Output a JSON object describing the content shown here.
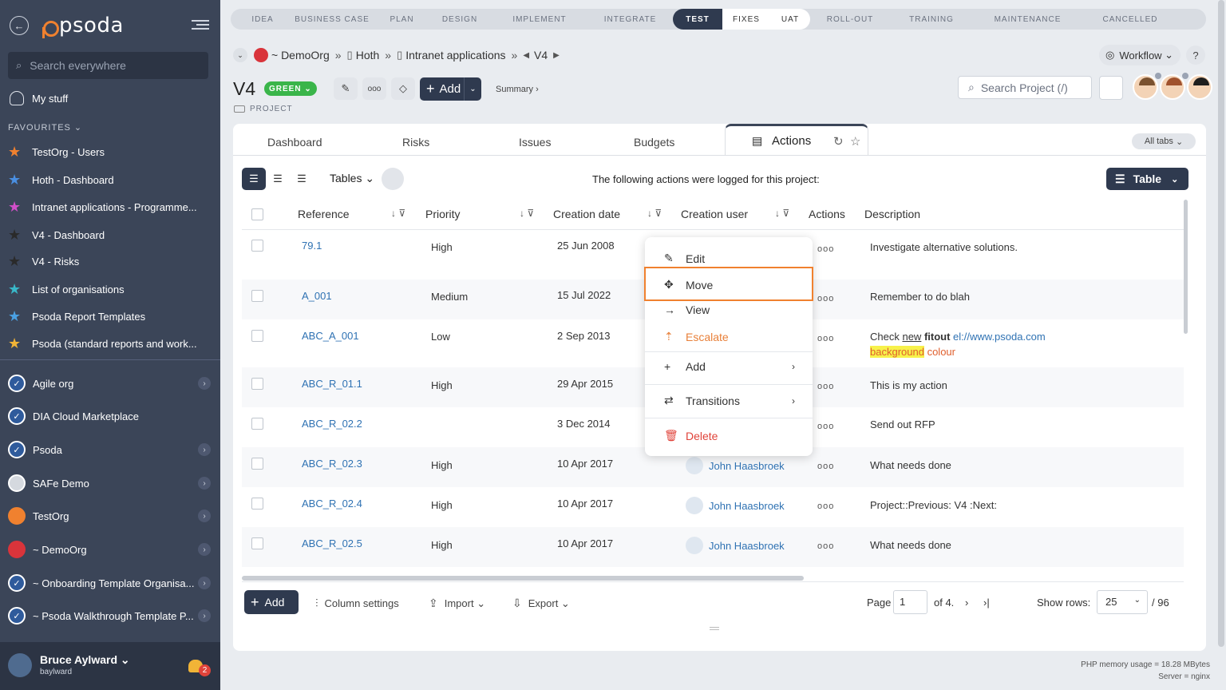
{
  "sidebar": {
    "logo": "psoda",
    "search_placeholder": "Search everywhere",
    "my_stuff": "My stuff",
    "favourites_heading": "FAVOURITES",
    "favourites": [
      {
        "label": "TestOrg - Users",
        "color": "#f0812f"
      },
      {
        "label": "Hoth - Dashboard",
        "color": "#4a8fe2"
      },
      {
        "label": "Intranet applications - Programme...",
        "color": "#d14fc9"
      },
      {
        "label": "V4 - Dashboard",
        "color": "#3a3a3a"
      },
      {
        "label": "V4 - Risks",
        "color": "#3a3a3a"
      },
      {
        "label": "List of organisations",
        "color": "#39b8c9"
      },
      {
        "label": "Psoda Report Templates",
        "color": "#4aa0e2"
      },
      {
        "label": "Psoda (standard reports and work...",
        "color": "#f1b437"
      }
    ],
    "orgs": [
      {
        "label": "Agile org"
      },
      {
        "label": "DIA Cloud Marketplace"
      },
      {
        "label": "Psoda"
      },
      {
        "label": "SAFe Demo"
      },
      {
        "label": "TestOrg"
      },
      {
        "label": "~ DemoOrg"
      },
      {
        "label": "~ Onboarding Template Organisa..."
      },
      {
        "label": "~ Psoda Walkthrough Template P..."
      }
    ],
    "user": {
      "name": "Bruce Aylward",
      "username": "baylward",
      "notifications": "2"
    }
  },
  "stages": [
    "IDEA",
    "BUSINESS CASE",
    "PLAN",
    "DESIGN",
    "IMPLEMENT",
    "INTEGRATE",
    "TEST",
    "FIXES",
    "UAT",
    "ROLL-OUT",
    "TRAINING",
    "MAINTENANCE",
    "CANCELLED"
  ],
  "breadcrumb": {
    "org": "~ DemoOrg",
    "prog": "Hoth",
    "proj": "Intranet applications",
    "item": "V4"
  },
  "workflow": "Workflow",
  "help": "?",
  "header": {
    "title": "V4",
    "status": "GREEN",
    "type": "PROJECT",
    "add": "Add",
    "summary": "Summary ›",
    "search_placeholder": "Search Project (/)"
  },
  "tabs": {
    "dashboard": "Dashboard",
    "risks": "Risks",
    "issues": "Issues",
    "budgets": "Budgets",
    "actions": "Actions",
    "all_tabs": "All tabs"
  },
  "toolbar": {
    "tables": "Tables",
    "intro": "The following actions were logged for this project:",
    "table_btn": "Table"
  },
  "columns": {
    "reference": "Reference",
    "priority": "Priority",
    "creation_date": "Creation date",
    "creation_user": "Creation user",
    "actions": "Actions",
    "description": "Description"
  },
  "rows": [
    {
      "ref": "79.1",
      "priority": "High",
      "date": "25 Jun 2008",
      "user": "",
      "desc": "Investigate alternative solutions."
    },
    {
      "ref": "A_001",
      "priority": "Medium",
      "date": "15 Jul 2022",
      "user": "",
      "desc": "Remember to do blah"
    },
    {
      "ref": "ABC_A_001",
      "priority": "Low",
      "date": "2 Sep 2013",
      "user": "",
      "desc_parts": {
        "a": "Check ",
        "b": "new",
        "c": " fitout ",
        "d": "el://www.psoda.com",
        "e": "background",
        "f": "colour"
      }
    },
    {
      "ref": "ABC_R_01.1",
      "priority": "High",
      "date": "29 Apr 2015",
      "user": "",
      "desc": "This is my action"
    },
    {
      "ref": "ABC_R_02.2",
      "priority": "",
      "date": "3 Dec 2014",
      "user": "",
      "desc": "Send out RFP"
    },
    {
      "ref": "ABC_R_02.3",
      "priority": "High",
      "date": "10 Apr 2017",
      "user": "John Haasbroek",
      "desc": "What needs done"
    },
    {
      "ref": "ABC_R_02.4",
      "priority": "High",
      "date": "10 Apr 2017",
      "user": "John Haasbroek",
      "desc": "Project::Previous: V4 :Next:"
    },
    {
      "ref": "ABC_R_02.5",
      "priority": "High",
      "date": "10 Apr 2017",
      "user": "John Haasbroek",
      "desc": "What needs done"
    }
  ],
  "context_menu": {
    "edit": "Edit",
    "move": "Move",
    "view": "View",
    "escalate": "Escalate",
    "add": "Add",
    "transitions": "Transitions",
    "delete": "Delete"
  },
  "bottom": {
    "add": "Add",
    "column_settings": "Column settings",
    "import": "Import",
    "export": "Export",
    "page_label": "Page",
    "page_value": "1",
    "of": "of 4.",
    "show_rows": "Show rows:",
    "rows_value": "25",
    "total": "/ 96"
  },
  "footer": {
    "memory": "PHP memory usage = 18.28 MBytes",
    "server": "Server = nginx"
  }
}
